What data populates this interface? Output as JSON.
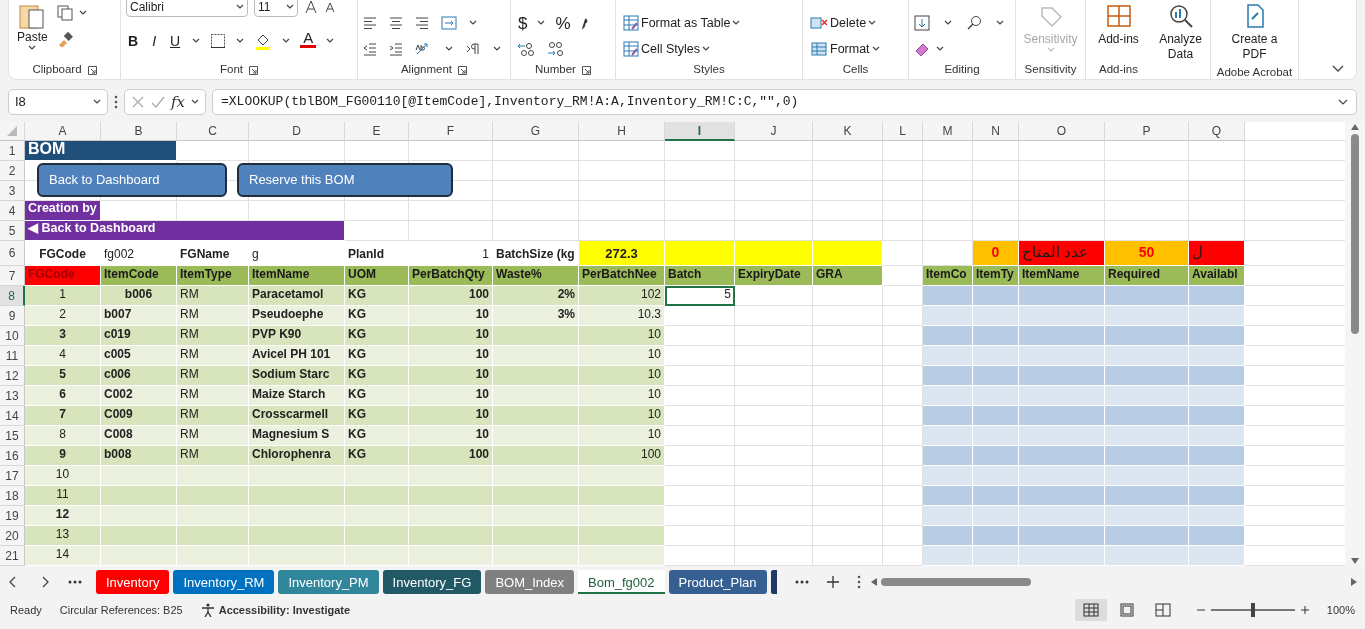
{
  "ribbon": {
    "groups": [
      {
        "kind": "clipboard",
        "label": "Clipboard",
        "paste_label": "Paste"
      },
      {
        "kind": "font",
        "label": "Font",
        "font_name": "Calibri",
        "font_size": "11",
        "style_buttons": [
          "B",
          "I",
          "U"
        ],
        "font_color_label": "A"
      },
      {
        "kind": "alignment",
        "label": "Alignment"
      },
      {
        "kind": "number",
        "label": "Number",
        "symbols": [
          "$",
          "%"
        ]
      },
      {
        "kind": "styles",
        "label": "Styles",
        "commands": [
          "Format as Table",
          "Cell Styles"
        ]
      },
      {
        "kind": "cells",
        "label": "Cells",
        "commands": [
          "Delete",
          "Format"
        ]
      },
      {
        "kind": "editing",
        "label": "Editing"
      },
      {
        "kind": "sensitivity",
        "label": "Sensitivity",
        "button": "Sensitivity",
        "disabled": true
      },
      {
        "kind": "addins",
        "label": "Add-ins",
        "button": "Add-ins"
      },
      {
        "kind": "analyze",
        "button": "Analyze Data"
      },
      {
        "kind": "acrobat",
        "label": "Adobe Acrobat",
        "button": "Create a PDF"
      }
    ]
  },
  "formula_bar": {
    "name_box": "I8",
    "function_label": "fx",
    "formula": "=XLOOKUP(tblBOM_FG00110[@ItemCode],Inventory_RM!A:A,Inventory_RM!C:C,\"\",0)"
  },
  "sheet": {
    "buttons": [
      "Back to Dashboard",
      "Reserve this BOM"
    ],
    "columns": [
      {
        "label": "A",
        "selected": false
      },
      {
        "label": "B",
        "selected": false
      },
      {
        "label": "C",
        "selected": false
      },
      {
        "label": "D",
        "selected": false
      },
      {
        "label": "E",
        "selected": false
      },
      {
        "label": "F",
        "selected": false
      },
      {
        "label": "G",
        "selected": false
      },
      {
        "label": "H",
        "selected": false
      },
      {
        "label": "I",
        "selected": true
      },
      {
        "label": "J",
        "selected": false
      },
      {
        "label": "K",
        "selected": false
      },
      {
        "label": "L",
        "selected": false
      },
      {
        "label": "M",
        "selected": false
      },
      {
        "label": "N",
        "selected": false
      },
      {
        "label": "O",
        "selected": false
      },
      {
        "label": "P",
        "selected": false
      },
      {
        "label": "Q",
        "selected": false
      }
    ],
    "rows": [
      {
        "number": "1",
        "selected": false,
        "kind": "plain",
        "cells": [
          {
            "text": "BOM",
            "kind": "title"
          },
          {
            "kind": "title"
          }
        ]
      },
      {
        "number": "2",
        "selected": false,
        "kind": "plain"
      },
      {
        "number": "3",
        "selected": false,
        "kind": "plain"
      },
      {
        "number": "4",
        "selected": false,
        "kind": "plain",
        "cells": [
          {
            "text": "Creation by",
            "kind": "banner"
          }
        ]
      },
      {
        "number": "5",
        "selected": false,
        "kind": "plain",
        "cells": [
          {
            "text": "◀ Back to Dashboard",
            "kind": "banner"
          },
          {
            "kind": "banner"
          },
          {
            "kind": "banner"
          },
          {
            "kind": "banner"
          }
        ]
      },
      {
        "number": "6",
        "selected": false,
        "kind": "info",
        "cells": [
          {
            "text": "FGCode",
            "kind": "bold-center"
          },
          {
            "text": "fg002",
            "kind": "text"
          },
          {
            "text": "FGName",
            "kind": "bold"
          },
          {
            "text": "g",
            "kind": "text"
          },
          {
            "text": "PlanId",
            "kind": "bold"
          },
          {
            "text": "1",
            "kind": "num"
          },
          {
            "text": "BatchSize (kg",
            "kind": "bold"
          },
          {
            "text": "272.3",
            "kind": "highlight"
          },
          {
            "kind": "highlight"
          },
          {
            "kind": "highlight"
          },
          {
            "kind": "highlight"
          },
          null,
          null,
          {
            "text": "0",
            "kind": "alert-orange"
          },
          {
            "text": "عدد المتاح",
            "kind": "alert-red"
          },
          {
            "text": "50",
            "kind": "alert-orange"
          },
          {
            "text": "ل",
            "kind": "alert-red"
          }
        ]
      },
      {
        "number": "7",
        "selected": false,
        "kind": "header",
        "cells": [
          {
            "text": "FGCode",
            "kind": "head-red"
          },
          {
            "text": "ItemCode",
            "kind": "head"
          },
          {
            "text": "ItemType",
            "kind": "head"
          },
          {
            "text": "ItemName",
            "kind": "head"
          },
          {
            "text": "UOM",
            "kind": "head"
          },
          {
            "text": "PerBatchQty",
            "kind": "head"
          },
          {
            "text": "Waste%",
            "kind": "head"
          },
          {
            "text": "PerBatchNee",
            "kind": "head"
          },
          {
            "text": "Batch",
            "kind": "head"
          },
          {
            "text": "ExpiryDate",
            "kind": "head"
          },
          {
            "text": "GRA",
            "kind": "head"
          },
          null,
          {
            "text": "ItemCo",
            "kind": "head"
          },
          {
            "text": "ItemTy",
            "kind": "head"
          },
          {
            "text": "ItemName",
            "kind": "head"
          },
          {
            "text": "Required",
            "kind": "head"
          },
          {
            "text": "Availabl",
            "kind": "head"
          }
        ]
      },
      {
        "number": "8",
        "selected": true,
        "kind": "table",
        "cells": [
          {
            "text": "1",
            "kind": "index"
          },
          {
            "text": "b006",
            "kind": "bold-center"
          },
          {
            "text": "RM",
            "kind": "text"
          },
          {
            "text": "Paracetamol",
            "kind": "bold"
          },
          {
            "text": "KG",
            "kind": "bold"
          },
          {
            "text": "100",
            "kind": "num-bold"
          },
          {
            "text": "2%",
            "kind": "num-bold"
          },
          {
            "text": "102",
            "kind": "num"
          },
          {
            "text": "5",
            "kind": "num-active"
          }
        ]
      },
      {
        "number": "9",
        "selected": false,
        "kind": "table",
        "cells": [
          {
            "text": "2",
            "kind": "index"
          },
          {
            "text": "b007",
            "kind": "bold"
          },
          {
            "text": "RM",
            "kind": "text"
          },
          {
            "text": "Pseudoephe",
            "kind": "bold"
          },
          {
            "text": "KG",
            "kind": "bold"
          },
          {
            "text": "10",
            "kind": "num-bold"
          },
          {
            "text": "3%",
            "kind": "num-bold"
          },
          {
            "text": "10.3",
            "kind": "num"
          }
        ]
      },
      {
        "number": "10",
        "selected": false,
        "kind": "table",
        "cells": [
          {
            "text": "3",
            "kind": "index-bold"
          },
          {
            "text": "c019",
            "kind": "bold"
          },
          {
            "text": "RM",
            "kind": "text"
          },
          {
            "text": "PVP K90",
            "kind": "bold"
          },
          {
            "text": "KG",
            "kind": "bold"
          },
          {
            "text": "10",
            "kind": "num-bold"
          },
          null,
          {
            "text": "10",
            "kind": "num"
          }
        ]
      },
      {
        "number": "11",
        "selected": false,
        "kind": "table",
        "cells": [
          {
            "text": "4",
            "kind": "index"
          },
          {
            "text": "c005",
            "kind": "bold"
          },
          {
            "text": "RM",
            "kind": "text"
          },
          {
            "text": "Avicel PH 101",
            "kind": "bold"
          },
          {
            "text": "KG",
            "kind": "bold"
          },
          {
            "text": "10",
            "kind": "num-bold"
          },
          null,
          {
            "text": "10",
            "kind": "num"
          }
        ]
      },
      {
        "number": "12",
        "selected": false,
        "kind": "table",
        "cells": [
          {
            "text": "5",
            "kind": "index-bold"
          },
          {
            "text": "c006",
            "kind": "bold"
          },
          {
            "text": "RM",
            "kind": "text"
          },
          {
            "text": "Sodium Starc",
            "kind": "bold"
          },
          {
            "text": "KG",
            "kind": "bold"
          },
          {
            "text": "10",
            "kind": "num-bold"
          },
          null,
          {
            "text": "10",
            "kind": "num"
          }
        ]
      },
      {
        "number": "13",
        "selected": false,
        "kind": "table",
        "cells": [
          {
            "text": "6",
            "kind": "index-bold"
          },
          {
            "text": "C002",
            "kind": "bold"
          },
          {
            "text": "RM",
            "kind": "text"
          },
          {
            "text": "Maize Starch",
            "kind": "bold"
          },
          {
            "text": "KG",
            "kind": "bold"
          },
          {
            "text": "10",
            "kind": "num-bold"
          },
          null,
          {
            "text": "10",
            "kind": "num"
          }
        ]
      },
      {
        "number": "14",
        "selected": false,
        "kind": "table",
        "cells": [
          {
            "text": "7",
            "kind": "index-bold"
          },
          {
            "text": "C009",
            "kind": "bold"
          },
          {
            "text": "RM",
            "kind": "text"
          },
          {
            "text": "Crosscarmell",
            "kind": "bold"
          },
          {
            "text": "KG",
            "kind": "bold"
          },
          {
            "text": "10",
            "kind": "num-bold"
          },
          null,
          {
            "text": "10",
            "kind": "num"
          }
        ]
      },
      {
        "number": "15",
        "selected": false,
        "kind": "table",
        "cells": [
          {
            "text": "8",
            "kind": "index"
          },
          {
            "text": "C008",
            "kind": "bold"
          },
          {
            "text": "RM",
            "kind": "text"
          },
          {
            "text": "Magnesium S",
            "kind": "bold"
          },
          {
            "text": "KG",
            "kind": "bold"
          },
          {
            "text": "10",
            "kind": "num-bold"
          },
          null,
          {
            "text": "10",
            "kind": "num"
          }
        ]
      },
      {
        "number": "16",
        "selected": false,
        "kind": "table",
        "cells": [
          {
            "text": "9",
            "kind": "index-bold"
          },
          {
            "text": "b008",
            "kind": "bold"
          },
          {
            "text": "RM",
            "kind": "text"
          },
          {
            "text": "Chlorophenra",
            "kind": "bold"
          },
          {
            "text": "KG",
            "kind": "bold"
          },
          {
            "text": "100",
            "kind": "num-bold"
          },
          null,
          {
            "text": "100",
            "kind": "num"
          }
        ]
      },
      {
        "number": "17",
        "selected": false,
        "kind": "table",
        "cells": [
          {
            "text": "10",
            "kind": "index"
          }
        ]
      },
      {
        "number": "18",
        "selected": false,
        "kind": "table",
        "cells": [
          {
            "text": "11",
            "kind": "index"
          }
        ]
      },
      {
        "number": "19",
        "selected": false,
        "kind": "table",
        "cells": [
          {
            "text": "12",
            "kind": "index-bold"
          }
        ]
      },
      {
        "number": "20",
        "selected": false,
        "kind": "table",
        "cells": [
          {
            "text": "13",
            "kind": "index"
          }
        ]
      },
      {
        "number": "21",
        "selected": false,
        "kind": "table",
        "cells": [
          {
            "text": "14",
            "kind": "index"
          }
        ]
      }
    ]
  },
  "sheet_tabs": [
    {
      "label": "Inventory",
      "color": "#ff0000",
      "selected": false
    },
    {
      "label": "Inventory_RM",
      "color": "#0070c0",
      "selected": false
    },
    {
      "label": "Inventory_PM",
      "color": "#31869b",
      "selected": false
    },
    {
      "label": "Inventory_FG",
      "color": "#215967",
      "selected": false
    },
    {
      "label": "BOM_Index",
      "color": "#808080",
      "selected": false
    },
    {
      "label": "Bom_fg002",
      "color": "#217346",
      "selected": true
    },
    {
      "label": "Product_Plan",
      "color": "#366092",
      "selected": false
    }
  ],
  "status_bar": {
    "items": [
      "Ready",
      "Circular References: B25"
    ],
    "accessibility": "Accessibility: Investigate",
    "views": [
      {
        "kind": "normal",
        "selected": true
      },
      {
        "kind": "page-layout",
        "selected": false
      },
      {
        "kind": "page-break",
        "selected": false
      }
    ],
    "zoom": {
      "level": 0.5,
      "reading": "100%"
    }
  }
}
